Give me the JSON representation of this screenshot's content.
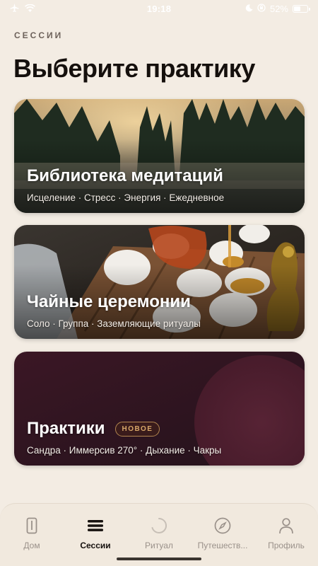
{
  "status_bar": {
    "time": "19:18",
    "battery": "52%",
    "battery_level": 0.52,
    "icons": [
      "airplane-icon",
      "wifi-icon",
      "moon-icon",
      "orientation-lock-icon",
      "battery-icon"
    ]
  },
  "header": {
    "eyebrow": "СЕССИИ",
    "title": "Выберите практику"
  },
  "cards": [
    {
      "title": "Библиотека медитаций",
      "tags": "Исцеление · Стресс · Энергия · Ежедневное",
      "image": "misty-forest-lake"
    },
    {
      "title": "Чайные церемонии",
      "tags": "Соло · Группа · Заземляющие ритуалы",
      "image": "tea-ceremony"
    },
    {
      "title": "Практики",
      "badge": "НОВОЕ",
      "tags": "Сандра · Иммерсив 270° · Дыхание · Чакры",
      "image": "dark-plum-gradient"
    }
  ],
  "tab_bar": {
    "active": "Сессии",
    "items": [
      {
        "label": "Дом",
        "icon": "phone-icon"
      },
      {
        "label": "Сессии",
        "icon": "stack-icon"
      },
      {
        "label": "Ритуал",
        "icon": "circle-progress-icon"
      },
      {
        "label": "Путешеств...",
        "icon": "compass-icon"
      },
      {
        "label": "Профиль",
        "icon": "person-icon"
      }
    ]
  },
  "colors": {
    "background": "#f3ece3",
    "title": "#15100d",
    "eyebrow": "#6d625b",
    "badge": "#d7a769",
    "tab_active": "#16110e",
    "tab_inactive": "#9a918a"
  }
}
